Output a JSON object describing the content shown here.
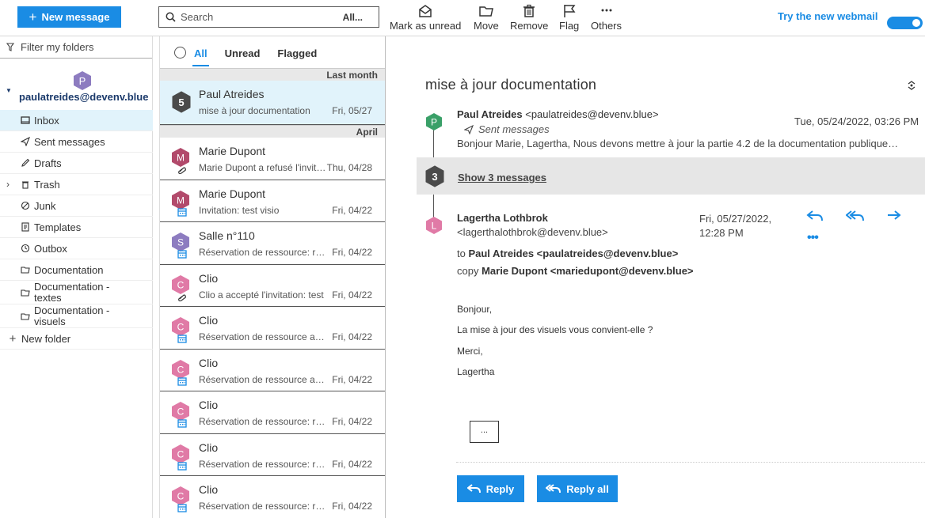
{
  "toolbar": {
    "new_message": "New message",
    "search_placeholder": "Search",
    "search_scope": "All...",
    "actions": [
      {
        "label": "Mark as unread",
        "icon": "envelope-open-icon"
      },
      {
        "label": "Move",
        "icon": "folder-icon"
      },
      {
        "label": "Remove",
        "icon": "trash-icon"
      },
      {
        "label": "Flag",
        "icon": "flag-icon"
      },
      {
        "label": "Others",
        "icon": "more-dots-icon"
      }
    ],
    "try_new": "Try the new webmail"
  },
  "sidebar": {
    "filter_label": "Filter my folders",
    "account_initial": "P",
    "account_email": "paulatreides@devenv.blue",
    "folders": [
      {
        "label": "Inbox",
        "icon": "inbox-icon"
      },
      {
        "label": "Sent messages",
        "icon": "send-icon"
      },
      {
        "label": "Drafts",
        "icon": "pencil-icon"
      },
      {
        "label": "Trash",
        "icon": "trash-icon"
      },
      {
        "label": "Junk",
        "icon": "junk-icon"
      },
      {
        "label": "Templates",
        "icon": "template-icon"
      },
      {
        "label": "Outbox",
        "icon": "clock-icon"
      },
      {
        "label": "Documentation",
        "icon": "folder-icon"
      },
      {
        "label": "Documentation - textes",
        "icon": "folder-icon"
      },
      {
        "label": "Documentation - visuels",
        "icon": "folder-icon"
      }
    ],
    "new_folder": "New folder"
  },
  "list": {
    "tabs": [
      "All",
      "Unread",
      "Flagged"
    ],
    "groups": [
      "Last month",
      "April"
    ],
    "selected": {
      "count": "5",
      "from": "Paul Atreides",
      "subject": "mise à jour documentation",
      "date": "Fri, 05/27"
    },
    "messages": [
      {
        "initial": "M",
        "color": "#b24a6b",
        "from": "Marie Dupont",
        "subject": "Marie Dupont a refusé l'invitation",
        "date": "Thu, 04/28",
        "icon": "paperclip-icon"
      },
      {
        "initial": "M",
        "color": "#b24a6b",
        "from": "Marie Dupont",
        "subject": "Invitation: test visio",
        "date": "Fri, 04/22",
        "icon": "calendar-icon"
      },
      {
        "initial": "S",
        "color": "#8d7cc0",
        "from": "Salle n°110",
        "subject": "Réservation de ressource: réunion",
        "date": "Fri, 04/22",
        "icon": "calendar-icon"
      },
      {
        "initial": "C",
        "color": "#e07aa6",
        "from": "Clio",
        "subject": "Clio a accepté l'invitation: test",
        "date": "Fri, 04/22",
        "icon": "paperclip-icon"
      },
      {
        "initial": "C",
        "color": "#e07aa6",
        "from": "Clio",
        "subject": "Réservation de ressource acceptée",
        "date": "Fri, 04/22",
        "icon": "calendar-icon"
      },
      {
        "initial": "C",
        "color": "#e07aa6",
        "from": "Clio",
        "subject": "Réservation de ressource acceptée",
        "date": "Fri, 04/22",
        "icon": "calendar-icon"
      },
      {
        "initial": "C",
        "color": "#e07aa6",
        "from": "Clio",
        "subject": "Réservation de ressource: réunion",
        "date": "Fri, 04/22",
        "icon": "calendar-icon"
      },
      {
        "initial": "C",
        "color": "#e07aa6",
        "from": "Clio",
        "subject": "Réservation de ressource: réunion",
        "date": "Fri, 04/22",
        "icon": "calendar-icon"
      },
      {
        "initial": "C",
        "color": "#e07aa6",
        "from": "Clio",
        "subject": "Réservation de ressource: réunion",
        "date": "Fri, 04/22",
        "icon": "calendar-icon"
      }
    ]
  },
  "reader": {
    "title": "mise à jour documentation",
    "first": {
      "initial": "P",
      "color": "#3aa068",
      "name": "Paul Atreides",
      "email": "<paulatreides@devenv.blue>",
      "folder": "Sent messages",
      "date": "Tue, 05/24/2022, 03:26 PM",
      "preview": "Bonjour Marie, Lagertha, Nous devons mettre à jour la partie 4.2 de la documentation publique…"
    },
    "collapsed_count": "3",
    "show_label": "Show 3 messages",
    "last": {
      "initial": "L",
      "color": "#e07aa6",
      "name": "Lagertha Lothbrok",
      "email": "<lagerthalothbrok@devenv.blue>",
      "date": "Fri, 05/27/2022, 12:28 PM",
      "to_label": "to",
      "to": "Paul Atreides <paulatreides@devenv.blue>",
      "cc_label": "copy",
      "cc": "Marie Dupont <mariedupont@devenv.blue>",
      "body": [
        "Bonjour,",
        "La mise à jour des visuels vous convient-elle ?",
        "Merci,",
        "Lagertha"
      ],
      "more_quoted": "..."
    },
    "reply": "Reply",
    "reply_all": "Reply all"
  },
  "colors": {
    "accent": "#1a8ce4",
    "selected_bg": "#e1f3fb",
    "account": "#8d7cc0"
  }
}
